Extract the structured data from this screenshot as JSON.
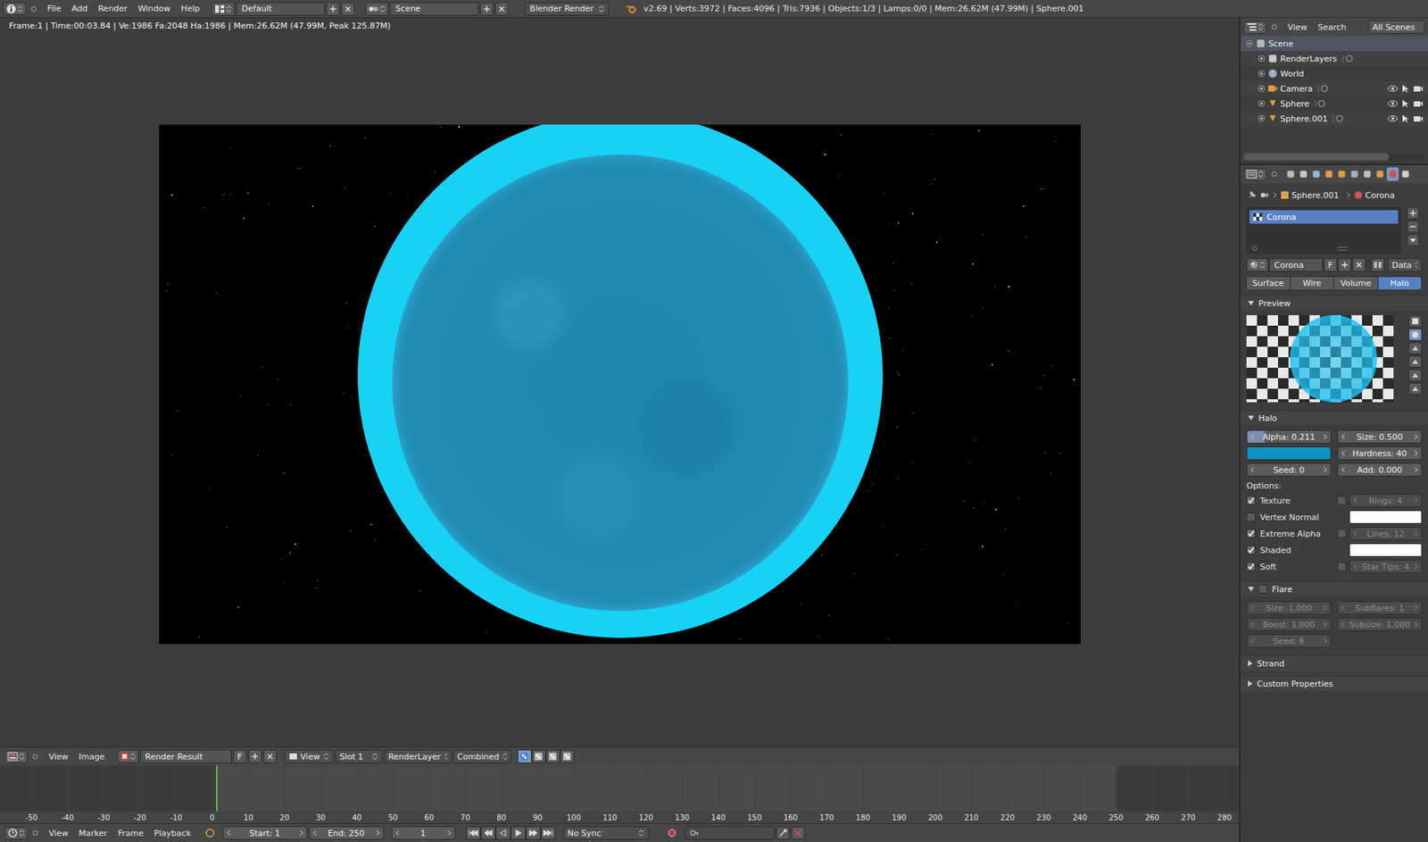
{
  "info_header": {
    "menus": [
      "File",
      "Add",
      "Render",
      "Window",
      "Help"
    ],
    "layout": "Default",
    "scene": "Scene",
    "engine": "Blender Render",
    "stats": "v2.69 | Verts:3972 | Faces:4096 | Tris:7936 | Objects:1/3 | Lamps:0/0 | Mem:26.62M (47.99M) | Sphere.001"
  },
  "image_editor": {
    "render_info": "Frame:1 | Time:00:03.84 | Ve:1986 Fa:2048 Ha:1986 | Mem:26.62M (47.99M, Peak 125.87M)",
    "menus": [
      "View",
      "Image"
    ],
    "image": "Render Result",
    "fake_user": "F",
    "view": "View",
    "slot": "Slot 1",
    "layer": "RenderLayer",
    "pass": "Combined",
    "display_modes": [
      {
        "selected": true
      },
      {
        "selected": false
      },
      {
        "selected": false
      },
      {
        "selected": false
      }
    ]
  },
  "timeline": {
    "ruler": [
      "-50",
      "-40",
      "-30",
      "-20",
      "-10",
      "0",
      "10",
      "20",
      "30",
      "40",
      "50",
      "60",
      "70",
      "80",
      "90",
      "100",
      "110",
      "120",
      "130",
      "140",
      "150",
      "160",
      "170",
      "180",
      "190",
      "200",
      "210",
      "220",
      "230",
      "240",
      "250",
      "260",
      "270",
      "280"
    ],
    "menus": [
      "View",
      "Marker",
      "Frame",
      "Playback"
    ],
    "start": "Start: 1",
    "end": "End: 250",
    "frame": "1",
    "sync": "No Sync"
  },
  "outliner": {
    "menus": [
      "View",
      "Search"
    ],
    "filter": "All Scenes",
    "items": [
      {
        "name": "Scene",
        "kind": "scene",
        "depth": 0,
        "expanded": true,
        "selected": true,
        "restrict": null
      },
      {
        "name": "RenderLayers",
        "kind": "render-layers",
        "depth": 1,
        "expanded": false,
        "selected": false,
        "restrict": null
      },
      {
        "name": "World",
        "kind": "world",
        "depth": 1,
        "expanded": false,
        "selected": false,
        "restrict": null
      },
      {
        "name": "Camera",
        "kind": "camera",
        "depth": 1,
        "expanded": false,
        "selected": false,
        "restrict": {
          "visible": true,
          "selectable": true,
          "renderable": true
        }
      },
      {
        "name": "Sphere",
        "kind": "mesh",
        "depth": 1,
        "expanded": false,
        "selected": false,
        "restrict": {
          "visible": true,
          "selectable": true,
          "renderable": true
        }
      },
      {
        "name": "Sphere.001",
        "kind": "mesh",
        "depth": 1,
        "expanded": false,
        "selected": false,
        "restrict": {
          "visible": true,
          "selectable": true,
          "renderable": true
        }
      }
    ]
  },
  "properties": {
    "context_tabs": [
      {
        "selected": false
      },
      {
        "selected": false
      },
      {
        "selected": false
      },
      {
        "selected": false
      },
      {
        "selected": false
      },
      {
        "selected": false
      },
      {
        "selected": false
      },
      {
        "selected": false
      },
      {
        "selected": true
      },
      {
        "selected": false
      }
    ],
    "breadcrumb": [
      "Sphere.001",
      "Corona"
    ],
    "slots": [
      {
        "name": "Corona",
        "selected": true
      }
    ],
    "material": {
      "name": "Corona",
      "fake_user": "F",
      "link": "Data"
    },
    "material_types": [
      {
        "label": "Surface",
        "selected": false
      },
      {
        "label": "Wire",
        "selected": false
      },
      {
        "label": "Volume",
        "selected": false
      },
      {
        "label": "Halo",
        "selected": true
      }
    ],
    "preview": {
      "title": "Preview",
      "expanded": true,
      "shapes": [
        {
          "selected": false
        },
        {
          "selected": true
        },
        {
          "selected": false
        },
        {
          "selected": false
        },
        {
          "selected": false
        },
        {
          "selected": false
        }
      ]
    },
    "halo": {
      "title": "Halo",
      "expanded": true,
      "rows": [
        [
          {
            "kind": "slider",
            "label": "Alpha: 0.211",
            "level": 0.211
          },
          {
            "kind": "number",
            "label": "Size: 0.500"
          }
        ],
        [
          {
            "kind": "color",
            "color": "#0f93c0"
          },
          {
            "kind": "number",
            "label": "Hardness: 40"
          }
        ],
        [
          {
            "kind": "number",
            "label": "Seed: 0"
          },
          {
            "kind": "number",
            "label": "Add: 0.000"
          }
        ]
      ],
      "options_label": "Options:",
      "options": [
        {
          "label": "Texture",
          "checked": true
        },
        {
          "label": "Vertex Normal",
          "checked": false
        },
        {
          "label": "Extreme Alpha",
          "checked": true
        },
        {
          "label": "Shaded",
          "checked": true
        },
        {
          "label": "Soft",
          "checked": true
        }
      ],
      "extras": [
        {
          "kind": "toggle",
          "checked": false,
          "label": "Rings: 4",
          "disabled": true
        },
        {
          "kind": "color",
          "color": "#ffffff"
        },
        {
          "kind": "toggle",
          "checked": false,
          "label": "Lines: 12",
          "disabled": true
        },
        {
          "kind": "color",
          "color": "#ffffff"
        },
        {
          "kind": "toggle",
          "checked": false,
          "label": "Star Tips: 4",
          "disabled": true
        }
      ]
    },
    "flare": {
      "title": "Flare",
      "checked": false,
      "expanded": true,
      "disabled": true,
      "rows": [
        [
          "Size: 1.000",
          "Subflares: 1"
        ],
        [
          "Boost: 1.000",
          "Subsize: 1.000"
        ],
        [
          "Seed: 6"
        ]
      ]
    },
    "collapsed": [
      {
        "title": "Strand",
        "expanded": false
      },
      {
        "title": "Custom Properties",
        "expanded": false
      }
    ]
  }
}
